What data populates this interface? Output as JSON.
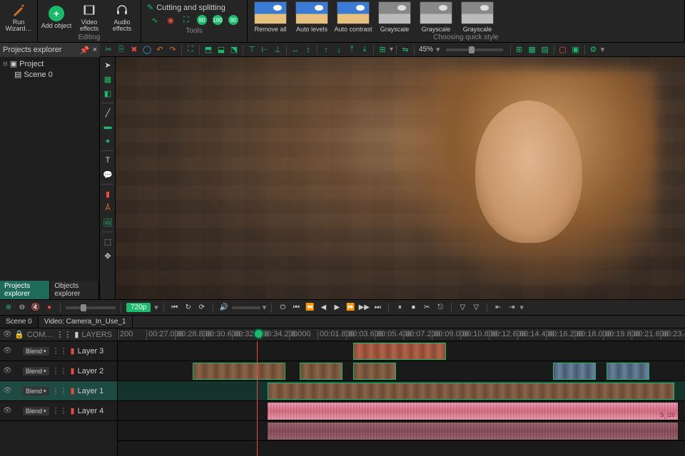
{
  "ribbon": {
    "run_wizard": "Run Wizard…",
    "add_object": "Add object",
    "video_effects": "Video effects",
    "audio_effects": "Audio effects",
    "editing_label": "Editing",
    "cutting_splitting": "Cutting and splitting",
    "tools_label": "Tools",
    "choosing_style": "Choosing quick style",
    "styles": [
      {
        "label": "Remove all",
        "gray": false
      },
      {
        "label": "Auto levels",
        "gray": false
      },
      {
        "label": "Auto contrast",
        "gray": false
      },
      {
        "label": "Grayscale",
        "gray": true
      },
      {
        "label": "Grayscale",
        "gray": true
      },
      {
        "label": "Grayscale",
        "gray": true
      }
    ]
  },
  "toolbar_zoom": "45%",
  "explorer": {
    "title": "Projects explorer",
    "project": "Project",
    "scene": "Scene 0",
    "tabs": [
      "Projects explorer",
      "Objects explorer"
    ]
  },
  "playback": {
    "resolution": "720p"
  },
  "scene_tabs": [
    "Scene 0",
    "Video: Camera_In_Use_1"
  ],
  "timeline": {
    "col_com": "COM…",
    "col_layers": "LAYERS",
    "tracks": [
      {
        "name": "Layer 3",
        "blend": "Blend"
      },
      {
        "name": "Layer 2",
        "blend": "Blend"
      },
      {
        "name": "Layer 1",
        "blend": "Blend"
      },
      {
        "name": "Layer 4",
        "blend": "Blend"
      }
    ],
    "ticks": [
      "200",
      "00:27.000",
      "00:28.800",
      "00:30.600",
      "00:32.400",
      "00:34.200",
      "0.000",
      "00:01.800",
      "00:03.600",
      "00:05.400",
      "00:07.200",
      "00:09.000",
      "00:10.800",
      "00:12.600",
      "00:14.400",
      "00:16.200",
      "00:18.000",
      "00:19.800",
      "00:21.600",
      "00:23.400"
    ],
    "end_label": "S_t20"
  }
}
